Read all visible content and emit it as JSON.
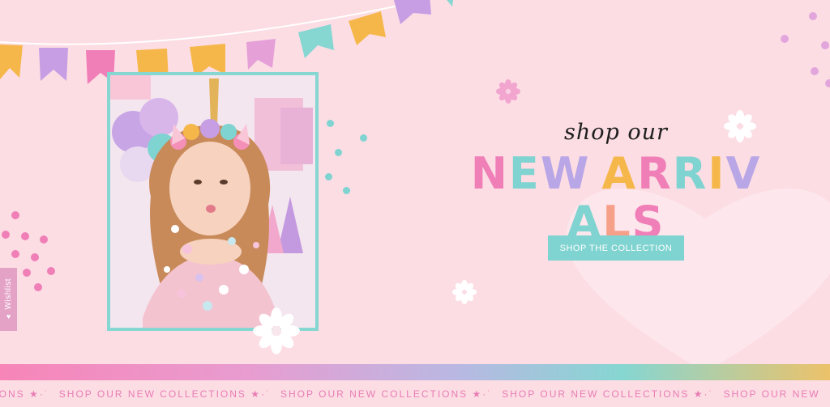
{
  "hero": {
    "script_heading": "shop our",
    "headline_letters": [
      {
        "ch": "N",
        "color": "#f07fb8"
      },
      {
        "ch": "E",
        "color": "#7fd3d0"
      },
      {
        "ch": "W",
        "color": "#b9a6e6"
      },
      {
        "ch": " ",
        "color": "#000000"
      },
      {
        "ch": "A",
        "color": "#f6b74a"
      },
      {
        "ch": "R",
        "color": "#f07fb8"
      },
      {
        "ch": "R",
        "color": "#7fd3d0"
      },
      {
        "ch": "I",
        "color": "#f6b74a"
      },
      {
        "ch": "V",
        "color": "#b9a6e6"
      },
      {
        "ch": "A",
        "color": "#7fd3d0"
      },
      {
        "ch": "L",
        "color": "#f6a08a"
      },
      {
        "ch": "S",
        "color": "#f07fb8"
      }
    ],
    "cta_label": "SHOP THE COLLECTION"
  },
  "wishlist": {
    "label": "Wishlist",
    "icon": "heart-icon"
  },
  "ticker": {
    "items": [
      "COLLECTIONS ★·˙",
      "SHOP OUR NEW COLLECTIONS ★·˙",
      "SHOP OUR NEW COLLECTIONS ★·˙",
      "SHOP OUR NEW COLLECTIONS ★·˙",
      "SHOP OUR NEW"
    ]
  },
  "colors": {
    "background": "#fcdde4",
    "accent_teal": "#7fd3d0",
    "accent_pink": "#f07fb8",
    "ticker_text": "#e87cb4"
  }
}
